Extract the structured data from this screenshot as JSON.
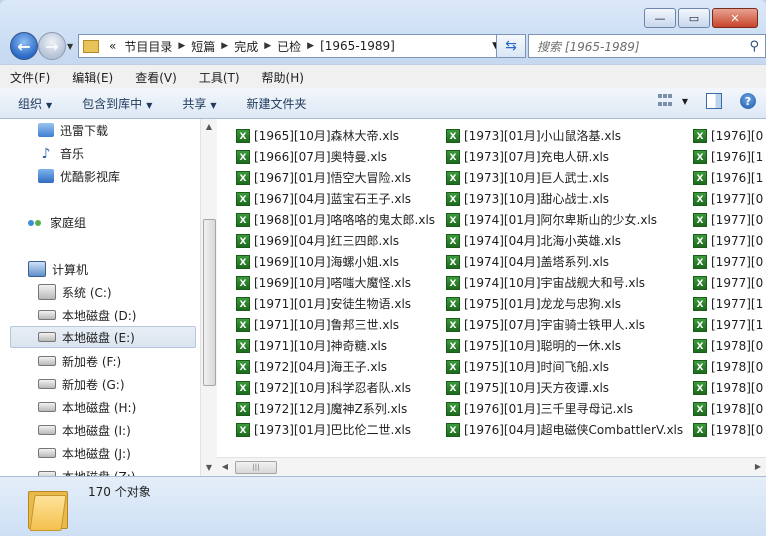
{
  "window": {
    "caption_buttons": [
      "—",
      "▭",
      "✕"
    ]
  },
  "address": {
    "path": [
      "节目目录",
      "短篇",
      "完成",
      "已检",
      "[1965-1989]"
    ],
    "prefix": "«"
  },
  "search": {
    "placeholder": "搜索 [1965-1989]"
  },
  "menu": [
    "文件(F)",
    "编辑(E)",
    "查看(V)",
    "工具(T)",
    "帮助(H)"
  ],
  "toolbar": {
    "organize": "组织",
    "include_library": "包含到库中",
    "share": "共享",
    "new_folder": "新建文件夹"
  },
  "nav": {
    "favorites": [
      {
        "label": "迅雷下载",
        "icon": "thunder-icon"
      },
      {
        "label": "音乐",
        "icon": "music-icon"
      },
      {
        "label": "优酷影视库",
        "icon": "video-library-icon"
      }
    ],
    "homegroup": {
      "label": "家庭组",
      "icon": "homegroup-icon"
    },
    "computer": {
      "label": "计算机",
      "icon": "computer-icon"
    },
    "drives": [
      {
        "label": "系统 (C:)",
        "icon": "system-drive-icon"
      },
      {
        "label": "本地磁盘 (D:)",
        "icon": "drive-icon"
      },
      {
        "label": "本地磁盘 (E:)",
        "icon": "drive-icon",
        "selected": true
      },
      {
        "label": "新加卷 (F:)",
        "icon": "drive-icon"
      },
      {
        "label": "新加卷 (G:)",
        "icon": "drive-icon"
      },
      {
        "label": "本地磁盘 (H:)",
        "icon": "drive-icon"
      },
      {
        "label": "本地磁盘 (I:)",
        "icon": "drive-icon"
      },
      {
        "label": "本地磁盘 (J:)",
        "icon": "drive-icon"
      },
      {
        "label": "本地磁盘 (Z:)",
        "icon": "drive-icon"
      }
    ]
  },
  "files": {
    "col1": [
      "[1965][10月]森林大帝.xls",
      "[1966][07月]奥特曼.xls",
      "[1967][01月]悟空大冒险.xls",
      "[1967][04月]蓝宝石王子.xls",
      "[1968][01月]咯咯咯的鬼太郎.xls",
      "[1969][04月]红三四郎.xls",
      "[1969][10月]海螺小姐.xls",
      "[1969][10月]嗒嗤大魔怪.xls",
      "[1971][01月]安徒生物语.xls",
      "[1971][10月]鲁邦三世.xls",
      "[1971][10月]神奇糖.xls",
      "[1972][04月]海王子.xls",
      "[1972][10月]科学忍者队.xls",
      "[1972][12月]魔神Z系列.xls",
      "[1973][01月]巴比伦二世.xls"
    ],
    "col2": [
      "[1973][01月]小山鼠洛基.xls",
      "[1973][07月]充电人研.xls",
      "[1973][10月]巨人武士.xls",
      "[1973][10月]甜心战士.xls",
      "[1974][01月]阿尔卑斯山的少女.xls",
      "[1974][04月]北海小英雄.xls",
      "[1974][04月]盖塔系列.xls",
      "[1974][10月]宇宙战舰大和号.xls",
      "[1975][01月]龙龙与忠狗.xls",
      "[1975][07月]宇宙骑士铁甲人.xls",
      "[1975][10月]聪明的一休.xls",
      "[1975][10月]时间飞船.xls",
      "[1975][10月]天方夜谭.xls",
      "[1976][01月]三千里寻母记.xls",
      "[1976][04月]超电磁侠CombattlerV.xls"
    ],
    "col3": [
      "[1976][0",
      "[1976][1",
      "[1976][1",
      "[1977][0",
      "[1977][0",
      "[1977][0",
      "[1977][0",
      "[1977][0",
      "[1977][1",
      "[1977][1",
      "[1978][0",
      "[1978][0",
      "[1978][0",
      "[1978][0",
      "[1978][0"
    ]
  },
  "status": {
    "count": "170 个对象"
  }
}
